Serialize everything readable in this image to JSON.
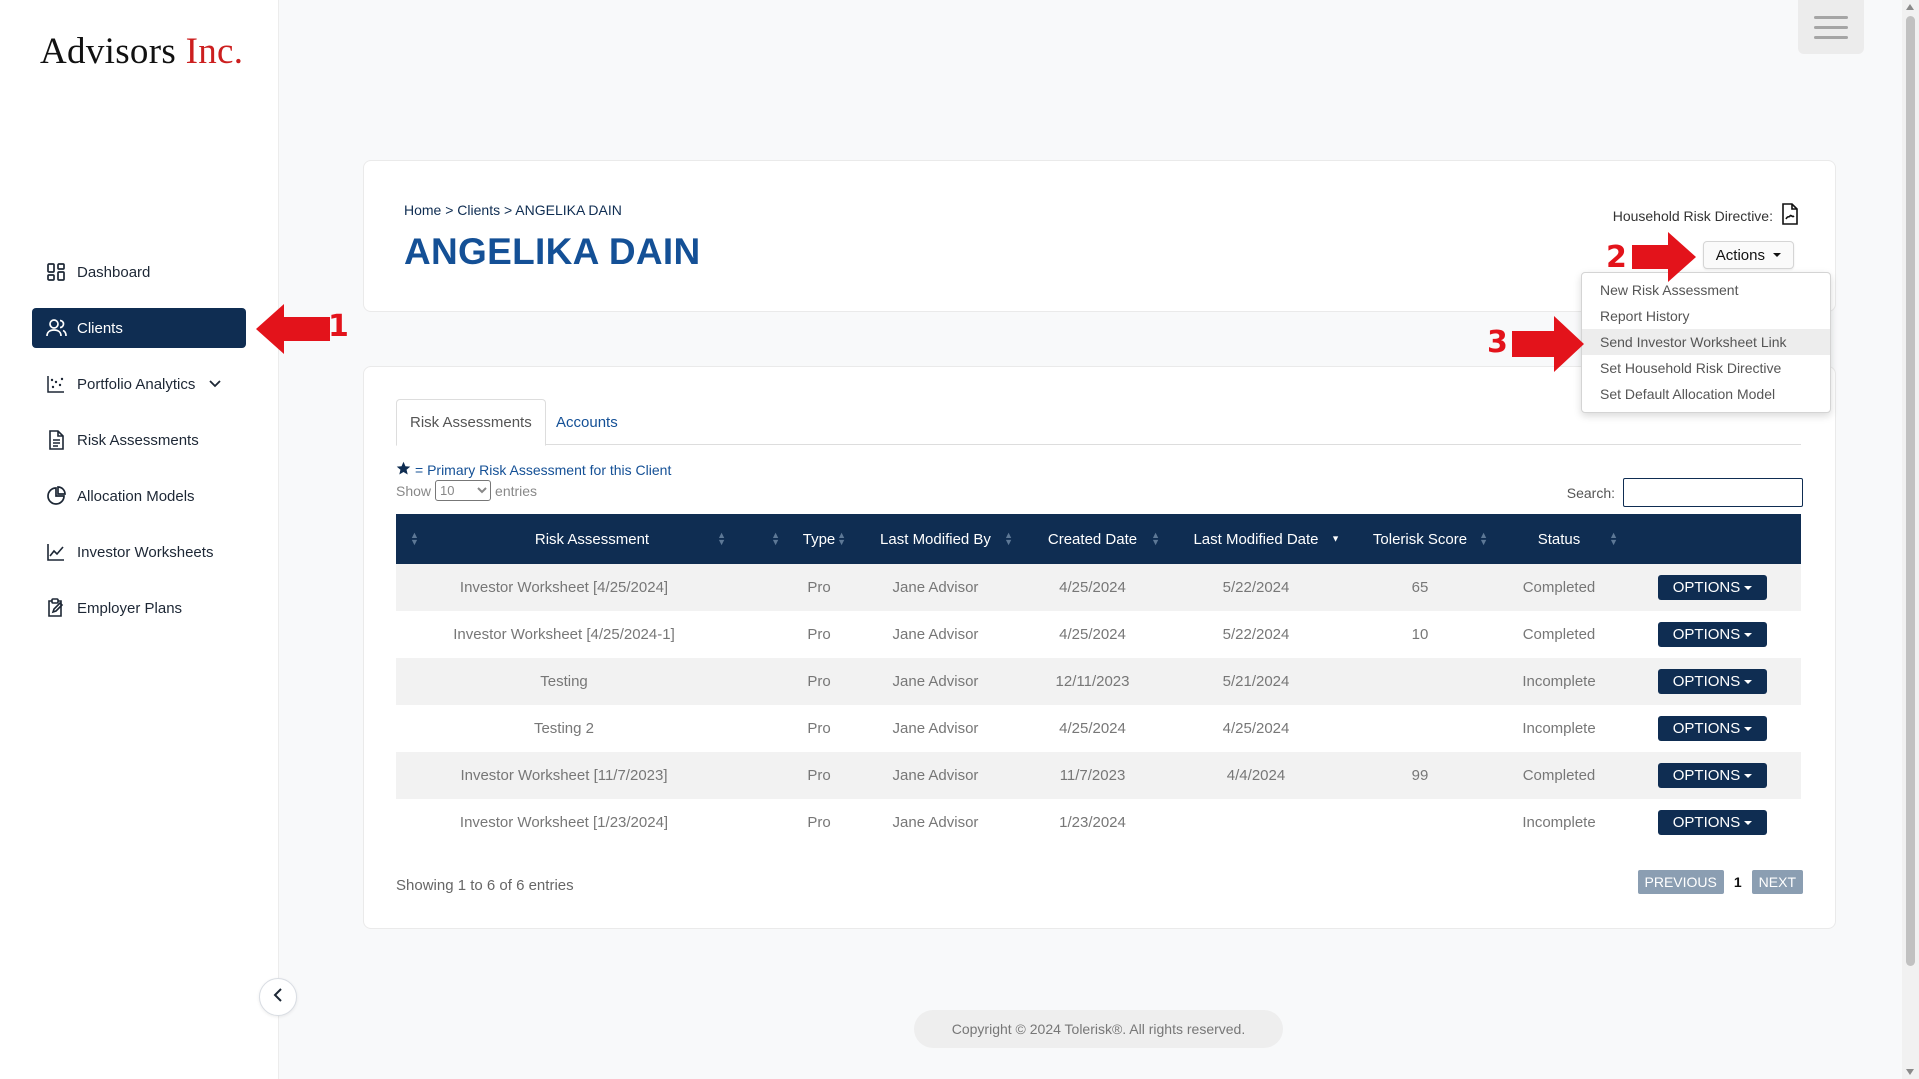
{
  "brand": {
    "name": "Advisors",
    "suffix": "Inc.",
    "accent_color": "#cc1f1f"
  },
  "sidebar": {
    "items": [
      {
        "label": "Dashboard",
        "icon": "dashboard-grid-icon",
        "active": false
      },
      {
        "label": "Clients",
        "icon": "users-icon",
        "active": true
      },
      {
        "label": "Portfolio Analytics",
        "icon": "scatter-chart-icon",
        "active": false,
        "expandable": true
      },
      {
        "label": "Risk Assessments",
        "icon": "document-icon",
        "active": false
      },
      {
        "label": "Allocation Models",
        "icon": "pie-chart-icon",
        "active": false
      },
      {
        "label": "Investor Worksheets",
        "icon": "line-chart-icon",
        "active": false
      },
      {
        "label": "Employer Plans",
        "icon": "clipboard-edit-icon",
        "active": false
      }
    ]
  },
  "header": {
    "breadcrumb": "Home > Clients > ANGELIKA DAIN",
    "title": "ANGELIKA DAIN",
    "household_label": "Household Risk Directive:",
    "actions_label": "Actions"
  },
  "actions_menu": {
    "items": [
      "New Risk Assessment",
      "Report History",
      "Send Investor Worksheet Link",
      "Set Household Risk Directive",
      "Set Default Allocation Model"
    ],
    "hovered_index": 2
  },
  "annotations": {
    "marker_1": "1",
    "marker_2": "2",
    "marker_3": "3",
    "color": "#e3131b"
  },
  "tabs": {
    "active": "Risk Assessments",
    "other": "Accounts"
  },
  "legend": "= Primary Risk Assessment for this Client",
  "length_menu": {
    "show": "Show",
    "value": "10",
    "entries": "entries"
  },
  "search": {
    "label": "Search:",
    "value": ""
  },
  "table": {
    "columns": [
      "Risk Assessment",
      "Type",
      "Last Modified By",
      "Created Date",
      "Last Modified Date",
      "Tolerisk Score",
      "Status"
    ],
    "options_label": "OPTIONS",
    "rows": [
      {
        "name": "Investor Worksheet [4/25/2024]",
        "type": "Pro",
        "modified_by": "Jane Advisor",
        "created": "4/25/2024",
        "modified": "5/22/2024",
        "score": "65",
        "status": "Completed"
      },
      {
        "name": "Investor Worksheet [4/25/2024-1]",
        "type": "Pro",
        "modified_by": "Jane Advisor",
        "created": "4/25/2024",
        "modified": "5/22/2024",
        "score": "10",
        "status": "Completed"
      },
      {
        "name": "Testing",
        "type": "Pro",
        "modified_by": "Jane Advisor",
        "created": "12/11/2023",
        "modified": "5/21/2024",
        "score": "",
        "status": "Incomplete"
      },
      {
        "name": "Testing 2",
        "type": "Pro",
        "modified_by": "Jane Advisor",
        "created": "4/25/2024",
        "modified": "4/25/2024",
        "score": "",
        "status": "Incomplete"
      },
      {
        "name": "Investor Worksheet [11/7/2023]",
        "type": "Pro",
        "modified_by": "Jane Advisor",
        "created": "11/7/2023",
        "modified": "4/4/2024",
        "score": "99",
        "status": "Completed"
      },
      {
        "name": "Investor Worksheet [1/23/2024]",
        "type": "Pro",
        "modified_by": "Jane Advisor",
        "created": "1/23/2024",
        "modified": "",
        "score": "",
        "status": "Incomplete"
      }
    ]
  },
  "info": "Showing 1 to 6 of 6 entries",
  "pagination": {
    "previous": "PREVIOUS",
    "current": "1",
    "next": "NEXT"
  },
  "footer": "Copyright © 2024 Tolerisk®. All rights reserved.",
  "colors": {
    "navy": "#0f2d52",
    "title_blue": "#145096"
  }
}
